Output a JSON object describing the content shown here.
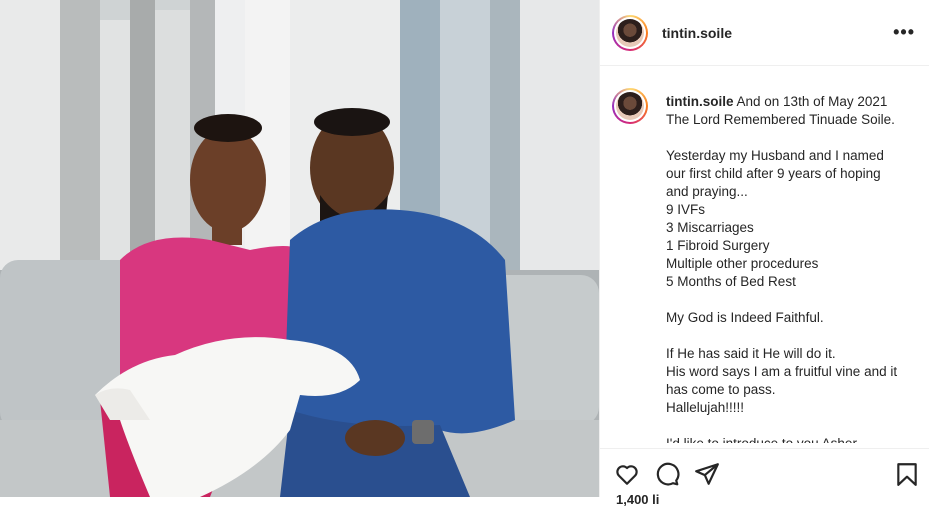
{
  "post": {
    "username": "tintin.soile",
    "more_icon": "more-horizontal-icon",
    "caption_username": "tintin.soile",
    "caption_lines": [
      "And on 13th of May 2021",
      "The Lord Remembered Tinuade Soile.",
      "",
      "Yesterday my Husband and I named",
      "our first child after 9 years of hoping",
      "and praying...",
      "9 IVFs",
      "3 Miscarriages",
      "1 Fibroid Surgery",
      "Multiple other procedures",
      "5 Months of Bed Rest",
      "",
      "My God is Indeed Faithful.",
      "",
      "If He has said it He will do it.",
      "His word says I am a fruitful vine and it",
      "has come to pass.",
      "Hallelujah!!!!!",
      "",
      "I'd like to introduce to you Asher"
    ],
    "likes_partial": "1,400 li"
  },
  "actions": {
    "like_icon": "heart-icon",
    "comment_icon": "comment-icon",
    "share_icon": "send-icon",
    "save_icon": "bookmark-icon"
  },
  "colors": {
    "text": "#262626",
    "border": "#efefef",
    "story_ring": "#d62976"
  }
}
